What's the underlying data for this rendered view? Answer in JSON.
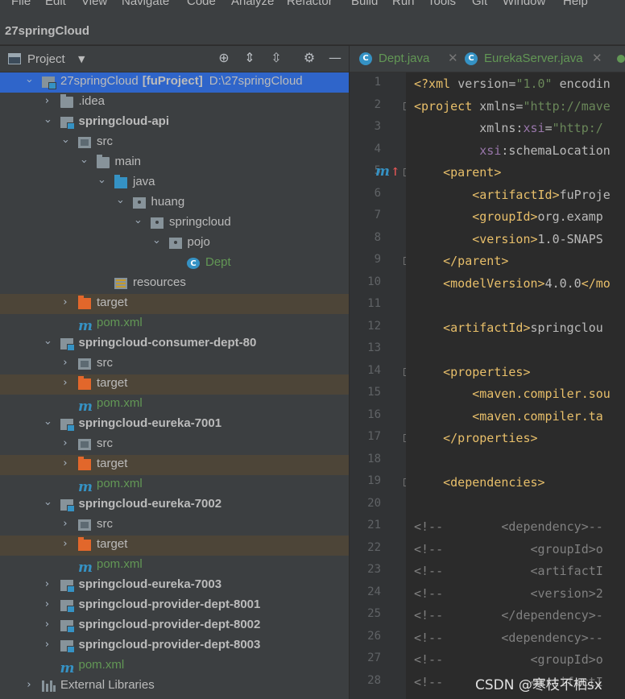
{
  "menu": [
    "File",
    "Edit",
    "View",
    "Navigate",
    "Code",
    "Analyze",
    "Refactor",
    "Build",
    "Run",
    "Tools",
    "Git",
    "Window",
    "Help"
  ],
  "window_title": "27springCloud",
  "project_panel": {
    "title": "Project",
    "toolbar_icons": [
      "locate-icon",
      "expand-all-icon",
      "collapse-all-icon",
      "gear-icon",
      "minimize-icon"
    ]
  },
  "tree": [
    {
      "label": "27springCloud",
      "extra": "[fuProject]",
      "path": "D:\\27springCloud",
      "icon": "module",
      "depth": 0,
      "arrow": "open",
      "bold": false,
      "selected": true
    },
    {
      "label": ".idea",
      "icon": "folder",
      "depth": 1,
      "arrow": "closed"
    },
    {
      "label": "springcloud-api",
      "icon": "module",
      "depth": 1,
      "arrow": "open",
      "bold": true
    },
    {
      "label": "src",
      "icon": "src",
      "depth": 2,
      "arrow": "open"
    },
    {
      "label": "main",
      "icon": "folder",
      "depth": 3,
      "arrow": "open"
    },
    {
      "label": "java",
      "icon": "java",
      "depth": 4,
      "arrow": "open"
    },
    {
      "label": "huang",
      "icon": "pkg",
      "depth": 5,
      "arrow": "open"
    },
    {
      "label": "springcloud",
      "icon": "pkg",
      "depth": 6,
      "arrow": "open"
    },
    {
      "label": "pojo",
      "icon": "pkg",
      "depth": 7,
      "arrow": "open"
    },
    {
      "label": "Dept",
      "icon": "class",
      "depth": 8,
      "arrow": "none",
      "cls": "cls"
    },
    {
      "label": "resources",
      "icon": "res",
      "depth": 4,
      "arrow": "none"
    },
    {
      "label": "target",
      "icon": "target",
      "depth": 2,
      "arrow": "closed",
      "hl": true
    },
    {
      "label": "pom.xml",
      "icon": "m",
      "depth": 2,
      "arrow": "none",
      "cls": "mvn"
    },
    {
      "label": "springcloud-consumer-dept-80",
      "icon": "module",
      "depth": 1,
      "arrow": "open",
      "bold": true
    },
    {
      "label": "src",
      "icon": "src",
      "depth": 2,
      "arrow": "closed"
    },
    {
      "label": "target",
      "icon": "target",
      "depth": 2,
      "arrow": "closed",
      "hl": true
    },
    {
      "label": "pom.xml",
      "icon": "m",
      "depth": 2,
      "arrow": "none",
      "cls": "mvn"
    },
    {
      "label": "springcloud-eureka-7001",
      "icon": "module",
      "depth": 1,
      "arrow": "open",
      "bold": true
    },
    {
      "label": "src",
      "icon": "src",
      "depth": 2,
      "arrow": "closed"
    },
    {
      "label": "target",
      "icon": "target",
      "depth": 2,
      "arrow": "closed",
      "hl": true
    },
    {
      "label": "pom.xml",
      "icon": "m",
      "depth": 2,
      "arrow": "none",
      "cls": "mvn"
    },
    {
      "label": "springcloud-eureka-7002",
      "icon": "module",
      "depth": 1,
      "arrow": "open",
      "bold": true
    },
    {
      "label": "src",
      "icon": "src",
      "depth": 2,
      "arrow": "closed"
    },
    {
      "label": "target",
      "icon": "target",
      "depth": 2,
      "arrow": "closed",
      "hl": true
    },
    {
      "label": "pom.xml",
      "icon": "m",
      "depth": 2,
      "arrow": "none",
      "cls": "mvn"
    },
    {
      "label": "springcloud-eureka-7003",
      "icon": "module",
      "depth": 1,
      "arrow": "closed",
      "bold": true
    },
    {
      "label": "springcloud-provider-dept-8001",
      "icon": "module",
      "depth": 1,
      "arrow": "closed",
      "bold": true
    },
    {
      "label": "springcloud-provider-dept-8002",
      "icon": "module",
      "depth": 1,
      "arrow": "closed",
      "bold": true
    },
    {
      "label": "springcloud-provider-dept-8003",
      "icon": "module",
      "depth": 1,
      "arrow": "closed",
      "bold": true
    },
    {
      "label": "pom.xml",
      "icon": "m",
      "depth": 1,
      "arrow": "none",
      "cls": "mvn"
    },
    {
      "label": "External Libraries",
      "icon": "lib",
      "depth": 0,
      "arrow": "closed"
    }
  ],
  "tabs": [
    {
      "label": "Dept.java",
      "icon": "class-icon"
    },
    {
      "label": "EurekaServer.java",
      "icon": "class-icon"
    }
  ],
  "code_lines": [
    [
      [
        "t",
        "<?xml "
      ],
      [
        "a",
        "version="
      ],
      [
        "v",
        "\"1.0\""
      ],
      [
        "a",
        " encodin"
      ]
    ],
    [
      [
        "t",
        "<project "
      ],
      [
        "a",
        "xmlns="
      ],
      [
        "v",
        "\"http://mave"
      ]
    ],
    [
      [
        "a",
        "         xmlns:"
      ],
      [
        "ns",
        "xsi"
      ],
      [
        "a",
        "="
      ],
      [
        "v",
        "\"http:/"
      ]
    ],
    [
      [
        "a",
        "         "
      ],
      [
        "ns",
        "xsi"
      ],
      [
        "a",
        ":schemaLocation"
      ]
    ],
    [
      [
        "t",
        "    <parent>"
      ]
    ],
    [
      [
        "t",
        "        <artifactId>"
      ],
      [
        "a",
        "fuProje"
      ]
    ],
    [
      [
        "t",
        "        <groupId>"
      ],
      [
        "a",
        "org.examp"
      ]
    ],
    [
      [
        "t",
        "        <version>"
      ],
      [
        "a",
        "1.0-SNAPS"
      ]
    ],
    [
      [
        "t",
        "    </parent>"
      ]
    ],
    [
      [
        "t",
        "    <modelVersion>"
      ],
      [
        "a",
        "4.0.0"
      ],
      [
        "t",
        "</mo"
      ]
    ],
    [],
    [
      [
        "t",
        "    <artifactId>"
      ],
      [
        "a",
        "springclou"
      ]
    ],
    [],
    [
      [
        "t",
        "    <properties>"
      ]
    ],
    [
      [
        "t",
        "        <maven.compiler.sou"
      ]
    ],
    [
      [
        "t",
        "        <maven.compiler.ta"
      ]
    ],
    [
      [
        "t",
        "    </properties>"
      ]
    ],
    [],
    [
      [
        "t",
        "    <dependencies>"
      ]
    ],
    [],
    [
      [
        "c",
        "<!--        <dependency>--"
      ]
    ],
    [
      [
        "c",
        "<!--            <groupId>o"
      ]
    ],
    [
      [
        "c",
        "<!--            <artifactI"
      ]
    ],
    [
      [
        "c",
        "<!--            <version>2"
      ]
    ],
    [
      [
        "c",
        "<!--        </dependency>-"
      ]
    ],
    [
      [
        "c",
        "<!--        <dependency>--"
      ]
    ],
    [
      [
        "c",
        "<!--            <groupId>o"
      ]
    ],
    [
      [
        "c",
        "<!--            <artifactI"
      ]
    ]
  ],
  "line_count": 28,
  "gutter_marker": {
    "letter": "m",
    "arrow": "↑"
  },
  "watermark": "CSDN @寒枝不栖sx"
}
